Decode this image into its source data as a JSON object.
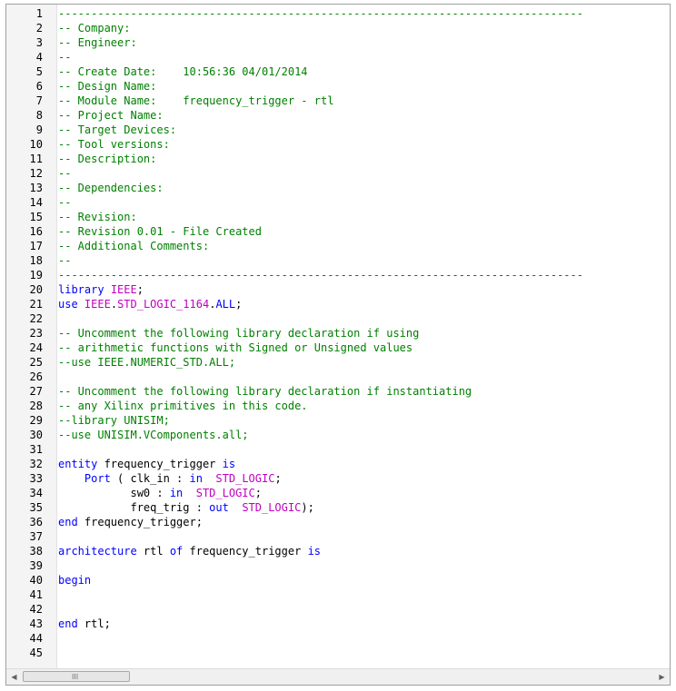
{
  "editor": {
    "lines": [
      [
        {
          "t": "c",
          "v": "--------------------------------------------------------------------------------"
        }
      ],
      [
        {
          "t": "c",
          "v": "-- Company:"
        }
      ],
      [
        {
          "t": "c",
          "v": "-- Engineer:"
        }
      ],
      [
        {
          "t": "c",
          "v": "--"
        }
      ],
      [
        {
          "t": "c",
          "v": "-- Create Date:    10:56:36 04/01/2014"
        }
      ],
      [
        {
          "t": "c",
          "v": "-- Design Name:"
        }
      ],
      [
        {
          "t": "c",
          "v": "-- Module Name:    frequency_trigger - rtl"
        }
      ],
      [
        {
          "t": "c",
          "v": "-- Project Name:"
        }
      ],
      [
        {
          "t": "c",
          "v": "-- Target Devices:"
        }
      ],
      [
        {
          "t": "c",
          "v": "-- Tool versions:"
        }
      ],
      [
        {
          "t": "c",
          "v": "-- Description:"
        }
      ],
      [
        {
          "t": "c",
          "v": "--"
        }
      ],
      [
        {
          "t": "c",
          "v": "-- Dependencies:"
        }
      ],
      [
        {
          "t": "c",
          "v": "--"
        }
      ],
      [
        {
          "t": "c",
          "v": "-- Revision:"
        }
      ],
      [
        {
          "t": "c",
          "v": "-- Revision 0.01 - File Created"
        }
      ],
      [
        {
          "t": "c",
          "v": "-- Additional Comments:"
        }
      ],
      [
        {
          "t": "c",
          "v": "--"
        }
      ],
      [
        {
          "t": "c",
          "v": "--------------------------------------------------------------------------------"
        }
      ],
      [
        {
          "t": "k",
          "v": "library"
        },
        {
          "t": "p",
          "v": " "
        },
        {
          "t": "y",
          "v": "IEEE"
        },
        {
          "t": "p",
          "v": ";"
        }
      ],
      [
        {
          "t": "k",
          "v": "use"
        },
        {
          "t": "p",
          "v": " "
        },
        {
          "t": "y",
          "v": "IEEE"
        },
        {
          "t": "p",
          "v": "."
        },
        {
          "t": "y",
          "v": "STD_LOGIC_1164"
        },
        {
          "t": "p",
          "v": "."
        },
        {
          "t": "k",
          "v": "ALL"
        },
        {
          "t": "p",
          "v": ";"
        }
      ],
      [],
      [
        {
          "t": "c",
          "v": "-- Uncomment the following library declaration if using"
        }
      ],
      [
        {
          "t": "c",
          "v": "-- arithmetic functions with Signed or Unsigned values"
        }
      ],
      [
        {
          "t": "c",
          "v": "--use IEEE.NUMERIC_STD.ALL;"
        }
      ],
      [],
      [
        {
          "t": "c",
          "v": "-- Uncomment the following library declaration if instantiating"
        }
      ],
      [
        {
          "t": "c",
          "v": "-- any Xilinx primitives in this code."
        }
      ],
      [
        {
          "t": "c",
          "v": "--library UNISIM;"
        }
      ],
      [
        {
          "t": "c",
          "v": "--use UNISIM.VComponents.all;"
        }
      ],
      [],
      [
        {
          "t": "k",
          "v": "entity"
        },
        {
          "t": "p",
          "v": " frequency_trigger "
        },
        {
          "t": "k",
          "v": "is"
        }
      ],
      [
        {
          "t": "p",
          "v": "    "
        },
        {
          "t": "k",
          "v": "Port"
        },
        {
          "t": "p",
          "v": " ( clk_in : "
        },
        {
          "t": "k",
          "v": "in"
        },
        {
          "t": "p",
          "v": "  "
        },
        {
          "t": "y",
          "v": "STD_LOGIC"
        },
        {
          "t": "p",
          "v": ";"
        }
      ],
      [
        {
          "t": "p",
          "v": "           sw0 : "
        },
        {
          "t": "k",
          "v": "in"
        },
        {
          "t": "p",
          "v": "  "
        },
        {
          "t": "y",
          "v": "STD_LOGIC"
        },
        {
          "t": "p",
          "v": ";"
        }
      ],
      [
        {
          "t": "p",
          "v": "           freq_trig : "
        },
        {
          "t": "k",
          "v": "out"
        },
        {
          "t": "p",
          "v": "  "
        },
        {
          "t": "y",
          "v": "STD_LOGIC"
        },
        {
          "t": "p",
          "v": ");"
        }
      ],
      [
        {
          "t": "k",
          "v": "end"
        },
        {
          "t": "p",
          "v": " frequency_trigger;"
        }
      ],
      [],
      [
        {
          "t": "k",
          "v": "architecture"
        },
        {
          "t": "p",
          "v": " rtl "
        },
        {
          "t": "k",
          "v": "of"
        },
        {
          "t": "p",
          "v": " frequency_trigger "
        },
        {
          "t": "k",
          "v": "is"
        }
      ],
      [],
      [
        {
          "t": "k",
          "v": "begin"
        }
      ],
      [],
      [],
      [
        {
          "t": "k",
          "v": "end"
        },
        {
          "t": "p",
          "v": " rtl;"
        }
      ],
      [],
      []
    ]
  },
  "scrollbar": {
    "left_arrow": "◀",
    "right_arrow": "▶",
    "thumb_grip": "III",
    "position": 0.0
  },
  "colors": {
    "comment": "#008000",
    "keyword": "#0000ff",
    "type": "#c000c0",
    "plain": "#000000"
  }
}
